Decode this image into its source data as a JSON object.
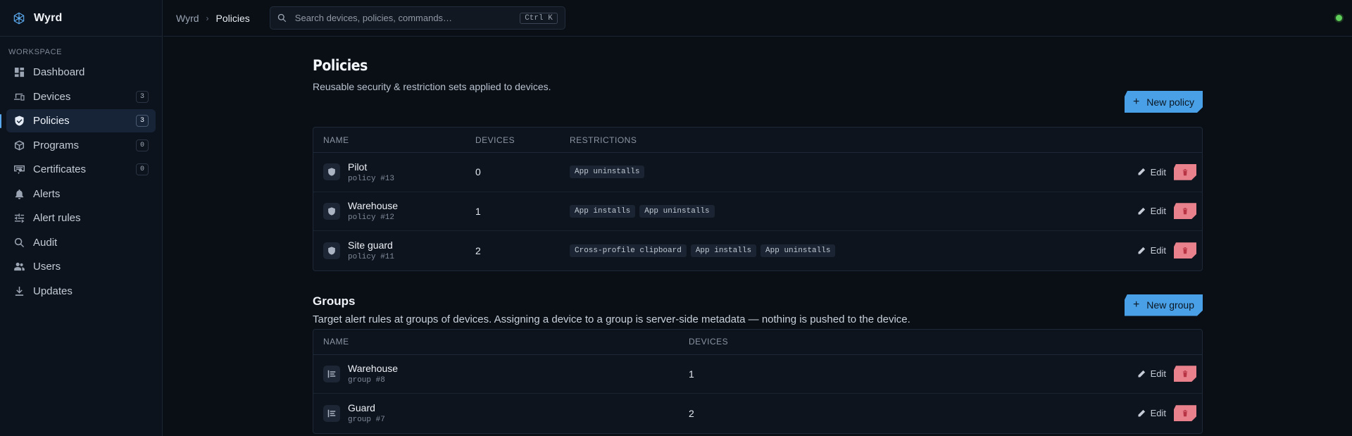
{
  "app": {
    "name": "Wyrd"
  },
  "sidebar": {
    "section_label": "WORKSPACE",
    "items": [
      {
        "label": "Dashboard",
        "icon": "dashboard-icon",
        "count": null,
        "active": false
      },
      {
        "label": "Devices",
        "icon": "devices-icon",
        "count": "3",
        "active": false
      },
      {
        "label": "Policies",
        "icon": "shield-icon",
        "count": "3",
        "active": true
      },
      {
        "label": "Programs",
        "icon": "package-icon",
        "count": "0",
        "active": false
      },
      {
        "label": "Certificates",
        "icon": "certificate-icon",
        "count": "0",
        "active": false
      },
      {
        "label": "Alerts",
        "icon": "bell-icon",
        "count": null,
        "active": false
      },
      {
        "label": "Alert rules",
        "icon": "sliders-icon",
        "count": null,
        "active": false
      },
      {
        "label": "Audit",
        "icon": "search-icon",
        "count": null,
        "active": false
      },
      {
        "label": "Users",
        "icon": "users-icon",
        "count": null,
        "active": false
      },
      {
        "label": "Updates",
        "icon": "download-icon",
        "count": null,
        "active": false
      }
    ]
  },
  "topbar": {
    "breadcrumb": {
      "root": "Wyrd",
      "separator": "›",
      "current": "Policies"
    },
    "search": {
      "placeholder": "Search devices, policies, commands…",
      "shortcut": "Ctrl K"
    },
    "status_color": "#5fce5b"
  },
  "policies": {
    "title": "Policies",
    "subtitle": "Reusable security & restriction sets applied to devices.",
    "new_button": "New policy",
    "columns": {
      "name": "NAME",
      "devices": "DEVICES",
      "restrictions": "RESTRICTIONS"
    },
    "rows": [
      {
        "name": "Pilot",
        "id": "policy #13",
        "devices": "0",
        "restrictions": [
          "App uninstalls"
        ]
      },
      {
        "name": "Warehouse",
        "id": "policy #12",
        "devices": "1",
        "restrictions": [
          "App installs",
          "App uninstalls"
        ]
      },
      {
        "name": "Site guard",
        "id": "policy #11",
        "devices": "2",
        "restrictions": [
          "Cross-profile clipboard",
          "App installs",
          "App uninstalls"
        ]
      }
    ]
  },
  "groups": {
    "title": "Groups",
    "subtitle": "Target alert rules at groups of devices. Assigning a device to a group is server-side metadata — nothing is pushed to the device.",
    "new_button": "New group",
    "columns": {
      "name": "NAME",
      "devices": "DEVICES"
    },
    "rows": [
      {
        "name": "Warehouse",
        "id": "group #8",
        "devices": "1"
      },
      {
        "name": "Guard",
        "id": "group #7",
        "devices": "2"
      }
    ]
  },
  "actions": {
    "edit_label": "Edit"
  },
  "colors": {
    "accent": "#4aa0e6",
    "danger": "#e8818c",
    "background": "#0a0f16"
  }
}
